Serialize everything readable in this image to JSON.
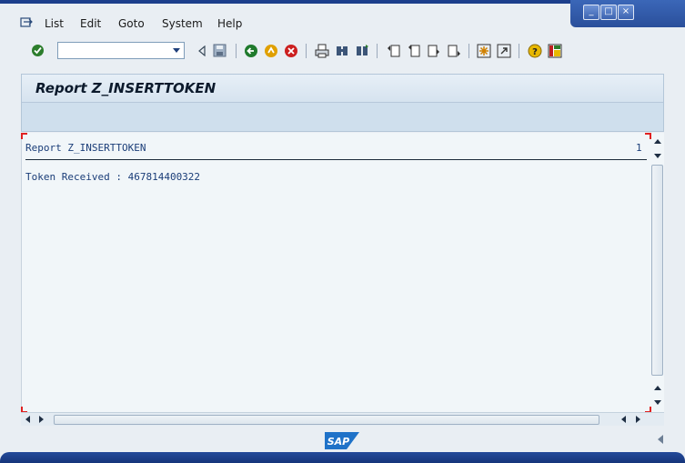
{
  "menu": {
    "items": [
      {
        "label": "List"
      },
      {
        "label": "Edit"
      },
      {
        "label": "Goto"
      },
      {
        "label": "System"
      },
      {
        "label": "Help"
      }
    ]
  },
  "toolbar": {
    "command_field_value": "",
    "icons": [
      "enter-icon",
      "back-icon",
      "save-icon",
      "back-green-icon",
      "exit-icon",
      "cancel-icon",
      "print-icon",
      "find-icon",
      "find-next-icon",
      "first-page-icon",
      "previous-page-icon",
      "next-page-icon",
      "last-page-icon",
      "create-session-icon",
      "create-shortcut-icon",
      "help-icon",
      "customize-layout-icon"
    ]
  },
  "page": {
    "title": "Report Z_INSERTTOKEN"
  },
  "report": {
    "header": "Report Z_INSERTTOKEN",
    "page_number": "1",
    "line": "Token Received : 467814400322"
  },
  "window": {
    "minimize": "_",
    "maximize": "□",
    "close": "×"
  },
  "status": {
    "logo_text": "SAP"
  },
  "colors": {
    "frame_blue": "#1c3f8c",
    "list_text": "#1a3d78",
    "list_background": "#f1f6f9",
    "title_band": "#cfdfed"
  }
}
